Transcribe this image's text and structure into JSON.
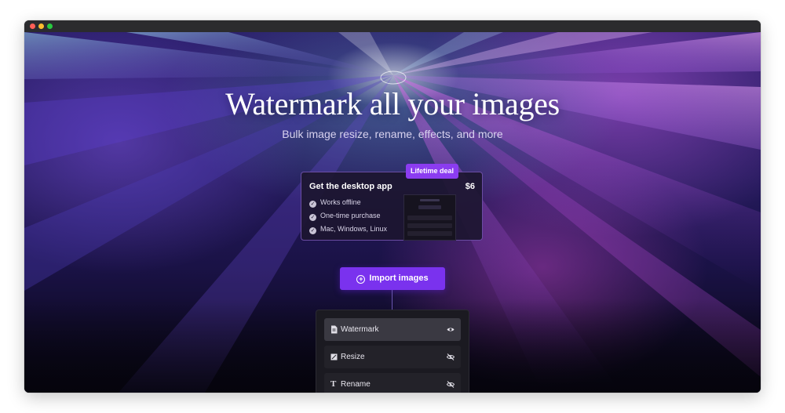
{
  "hero": {
    "headline": "Watermark all your images",
    "subheading": "Bulk image resize, rename, effects, and more"
  },
  "desktop_card": {
    "title": "Get the desktop app",
    "price": "$6",
    "badge": "Lifetime deal",
    "features": [
      "Works offline",
      "One-time purchase",
      "Mac, Windows, Linux"
    ]
  },
  "import_button": {
    "label": "Import images",
    "icon": "plus-circle-icon"
  },
  "steps": [
    {
      "label": "Watermark",
      "icon": "document-icon",
      "visible": true
    },
    {
      "label": "Resize",
      "icon": "resize-icon",
      "visible": false
    },
    {
      "label": "Rename",
      "icon": "text-icon",
      "visible": false
    }
  ],
  "colors": {
    "accent": "#7a32ee",
    "badge": "#8b3cf0",
    "panel": "#1b1a21",
    "titlebar": "#2b2b2e"
  }
}
